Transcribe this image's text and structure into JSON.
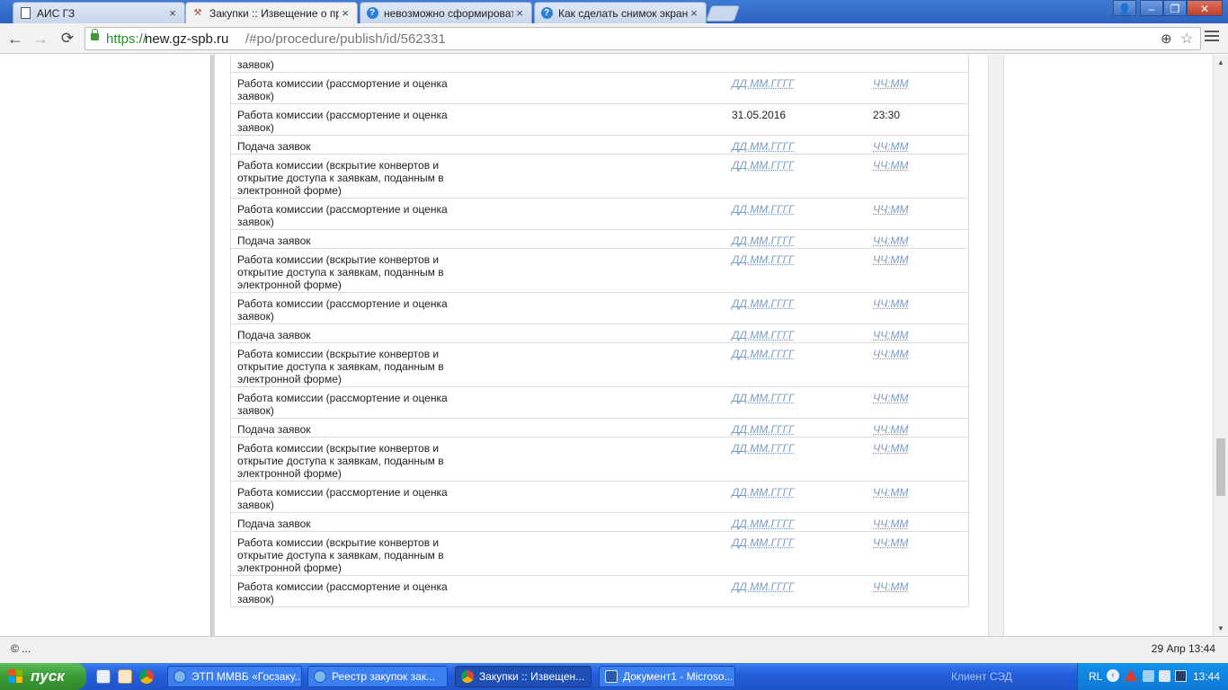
{
  "browser": {
    "tabs": [
      {
        "title": "АИС ГЗ",
        "icon": "document-icon",
        "active": false
      },
      {
        "title": "Закупки :: Извещение о пр",
        "icon": "hammer-icon",
        "active": true
      },
      {
        "title": "невозможно сформировать",
        "icon": "help-icon",
        "active": false
      },
      {
        "title": "Как сделать снимок экрана",
        "icon": "help-icon",
        "active": false
      }
    ],
    "close_glyph": "×",
    "window_buttons": {
      "user": "👤",
      "minimize": "–",
      "maximize": "❐",
      "close": "✕"
    },
    "nav": {
      "back": "←",
      "forward": "→",
      "reload": "⟳"
    },
    "url": {
      "scheme": "https://",
      "host": "new.gz-spb.ru",
      "path": "/#po/procedure/publish/id/562331"
    },
    "zoom_glyph": "⊕",
    "star_glyph": "☆"
  },
  "schedule": {
    "rows": [
      {
        "stage": "Работа комиссии (вскрытие конвертов и открытие доступа к заявкам, поданным в электронной форме) заявок)",
        "partial_text": "заявок)",
        "date": "",
        "time": ""
      },
      {
        "stage": "Работа комиссии (рассмортение и оценка заявок)",
        "date": "ДД.ММ.ГГГГ",
        "time": "ЧЧ:ММ",
        "placeholder": true
      },
      {
        "stage": "Работа комиссии (рассмортение и оценка заявок)",
        "date": "31.05.2016",
        "time": "23:30",
        "placeholder": false
      },
      {
        "stage": "Подача заявок",
        "date": "ДД.ММ.ГГГГ",
        "time": "ЧЧ:ММ",
        "placeholder": true
      },
      {
        "stage": "Работа комиссии (вскрытие конвертов и открытие доступа к заявкам, поданным в электронной форме)",
        "date": "ДД.ММ.ГГГГ",
        "time": "ЧЧ:ММ",
        "placeholder": true
      },
      {
        "stage": "Работа комиссии (рассмортение и оценка заявок)",
        "date": "ДД.ММ.ГГГГ",
        "time": "ЧЧ:ММ",
        "placeholder": true
      },
      {
        "stage": "Подача заявок",
        "date": "ДД.ММ.ГГГГ",
        "time": "ЧЧ:ММ",
        "placeholder": true
      },
      {
        "stage": "Работа комиссии (вскрытие конвертов и открытие доступа к заявкам, поданным в электронной форме)",
        "date": "ДД.ММ.ГГГГ",
        "time": "ЧЧ:ММ",
        "placeholder": true
      },
      {
        "stage": "Работа комиссии (рассмортение и оценка заявок)",
        "date": "ДД.ММ.ГГГГ",
        "time": "ЧЧ:ММ",
        "placeholder": true
      },
      {
        "stage": "Подача заявок",
        "date": "ДД.ММ.ГГГГ",
        "time": "ЧЧ:ММ",
        "placeholder": true
      },
      {
        "stage": "Работа комиссии (вскрытие конвертов и открытие доступа к заявкам, поданным в электронной форме)",
        "date": "ДД.ММ.ГГГГ",
        "time": "ЧЧ:ММ",
        "placeholder": true
      },
      {
        "stage": "Работа комиссии (рассмортение и оценка заявок)",
        "date": "ДД.ММ.ГГГГ",
        "time": "ЧЧ:ММ",
        "placeholder": true
      },
      {
        "stage": "Подача заявок",
        "date": "ДД.ММ.ГГГГ",
        "time": "ЧЧ:ММ",
        "placeholder": true
      },
      {
        "stage": "Работа комиссии (вскрытие конвертов и открытие доступа к заявкам, поданным в электронной форме)",
        "date": "ДД.ММ.ГГГГ",
        "time": "ЧЧ:ММ",
        "placeholder": true
      },
      {
        "stage": "Работа комиссии (рассмортение и оценка заявок)",
        "date": "ДД.ММ.ГГГГ",
        "time": "ЧЧ:ММ",
        "placeholder": true
      },
      {
        "stage": "Подача заявок",
        "date": "ДД.ММ.ГГГГ",
        "time": "ЧЧ:ММ",
        "placeholder": true
      },
      {
        "stage": "Работа комиссии (вскрытие конвертов и открытие доступа к заявкам, поданным в электронной форме)",
        "date": "ДД.ММ.ГГГГ",
        "time": "ЧЧ:ММ",
        "placeholder": true
      },
      {
        "stage": "Работа комиссии (рассмортение и оценка заявок)",
        "date": "ДД.ММ.ГГГГ",
        "time": "ЧЧ:ММ",
        "placeholder": true
      }
    ]
  },
  "scrollbar": {
    "up_glyph": "▲",
    "down_glyph": "▼",
    "position_fraction": 0.7
  },
  "statusbar": {
    "left": "© ...",
    "right": "29 Апр 13:44"
  },
  "taskbar": {
    "start_label": "пуск",
    "tasks": [
      {
        "label": "ЭТП ММВБ «Госзаку...",
        "icon": "ie-icon",
        "active": false
      },
      {
        "label": "Реестр закупок зак...",
        "icon": "ie-icon",
        "active": false
      },
      {
        "label": "Закупки :: Извещен...",
        "icon": "chrome-icon",
        "active": true
      },
      {
        "label": "Документ1 - Microso...",
        "icon": "word-icon",
        "active": false
      }
    ],
    "inactive_label": "Клиент СЭД",
    "tray": {
      "lang": "RL",
      "chevron": "‹",
      "clock": "13:44"
    }
  },
  "colors": {
    "placeholder_link": "#7a9cc4",
    "taskbar_blue": "#245edb",
    "start_green": "#3a9a33",
    "secure_green": "#2e8b2e"
  }
}
